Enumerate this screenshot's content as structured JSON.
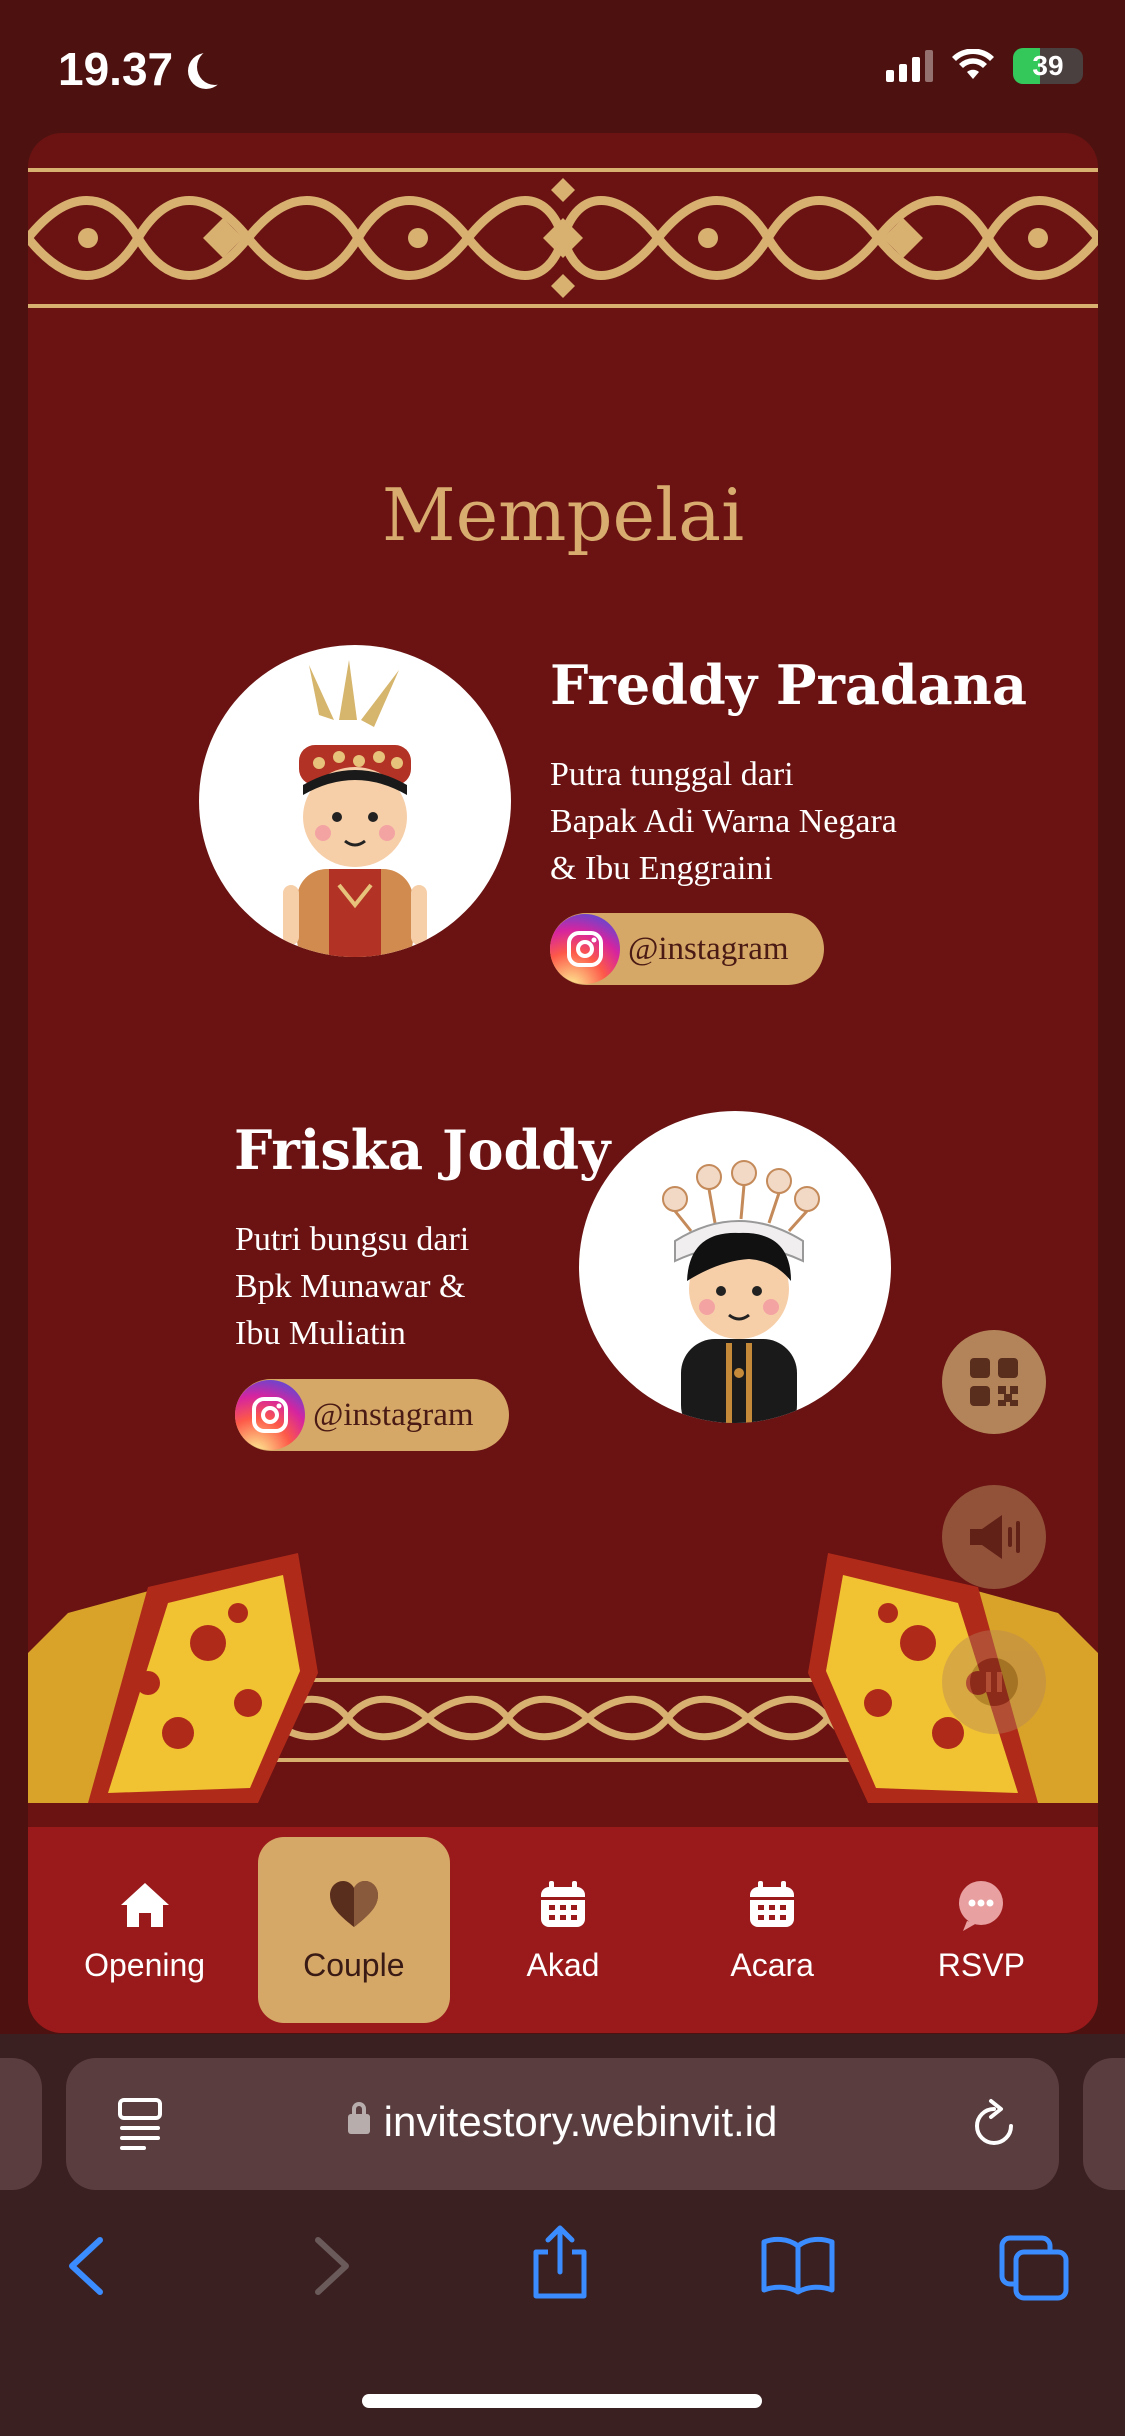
{
  "status_bar": {
    "time": "19.37",
    "battery": "39",
    "battery_level": 0.39
  },
  "section": {
    "title": "Mempelai"
  },
  "groom": {
    "name": "Freddy Pradana",
    "desc_lines": [
      "Putra tunggal dari",
      "Bapak Adi Warna Negara",
      "& Ibu Enggraini"
    ],
    "instagram": "@instagram"
  },
  "bride": {
    "name": "Friska Joddy",
    "desc_lines": [
      "Putri bungsu dari",
      "Bpk Munawar &",
      "Ibu Muliatin"
    ],
    "instagram": "@instagram"
  },
  "floating": [
    "qr-code-icon",
    "speaker-icon",
    "pause-icon"
  ],
  "nav": {
    "items": [
      {
        "label": "Opening",
        "icon": "home-icon"
      },
      {
        "label": "Couple",
        "icon": "heart-icon",
        "active": true
      },
      {
        "label": "Akad",
        "icon": "calendar-icon"
      },
      {
        "label": "Acara",
        "icon": "calendar-icon"
      },
      {
        "label": "RSVP",
        "icon": "chat-icon"
      }
    ]
  },
  "browser": {
    "url": "invitestory.webinvit.id"
  },
  "colors": {
    "background": "#6a1312",
    "gold": "#d6a867",
    "nav": "#9a1a1c",
    "accent_blue": "#3a8cff"
  }
}
